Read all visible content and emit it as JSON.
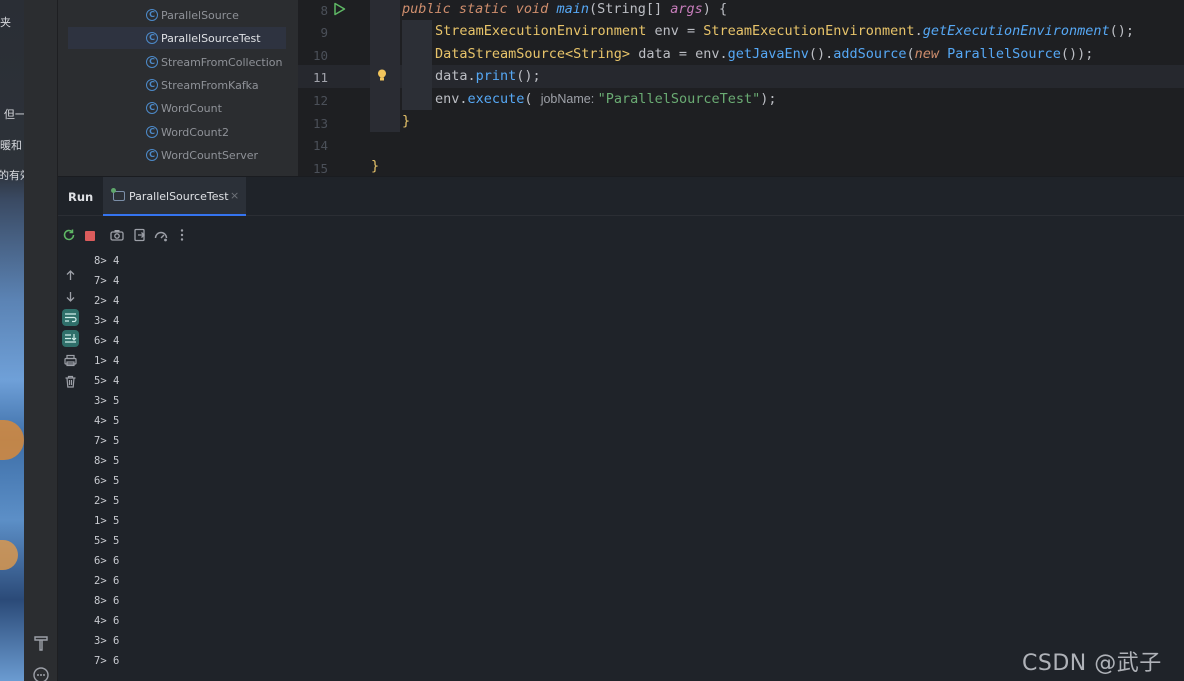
{
  "wallpaper": {
    "fragments": [
      "夹",
      "! 但一",
      "暖和",
      "的有效"
    ]
  },
  "project_tree": {
    "items": [
      {
        "label": "ParallelSource",
        "selected": false
      },
      {
        "label": "ParallelSourceTest",
        "selected": true
      },
      {
        "label": "StreamFromCollection",
        "selected": false
      },
      {
        "label": "StreamFromKafka",
        "selected": false
      },
      {
        "label": "WordCount",
        "selected": false
      },
      {
        "label": "WordCount2",
        "selected": false
      },
      {
        "label": "WordCountServer",
        "selected": false
      }
    ]
  },
  "editor": {
    "current_line": "11",
    "line_numbers": [
      "8",
      "9",
      "10",
      "11",
      "12",
      "13",
      "14",
      "15"
    ],
    "lines": {
      "l8": {
        "kw": "public static void ",
        "method": "main",
        "rest": "(String[] ",
        "param": "args",
        "end": ") {"
      },
      "l9": {
        "type": "StreamExecutionEnvironment",
        "mid": " env = ",
        "type2": "StreamExecutionEnvironment",
        "dot": ".",
        "method": "getExecutionEnvironment",
        "end": "();"
      },
      "l10": {
        "type": "DataStreamSource<String>",
        "mid": " data = env.",
        "method": "getJavaEnv",
        "mid2": "().",
        "method2": "addSource",
        "p1": "(",
        "kw": "new ",
        "cls": "ParallelSource",
        "end": "());"
      },
      "l11": {
        "pre": "data.",
        "method": "print",
        "end": "();"
      },
      "l12": {
        "pre": "env.",
        "method": "execute",
        "p": "( ",
        "hint": "jobName: ",
        "str": "\"ParallelSourceTest\"",
        "end": ");"
      },
      "l13": {
        "text": "}"
      },
      "l15": {
        "text": "}"
      }
    }
  },
  "run_panel": {
    "title": "Run",
    "tab_label": "ParallelSourceTest",
    "close_glyph": "×",
    "output": [
      "8> 4",
      "7> 4",
      "2> 4",
      "3> 4",
      "6> 4",
      "1> 4",
      "5> 4",
      "3> 5",
      "4> 5",
      "7> 5",
      "8> 5",
      "6> 5",
      "2> 5",
      "1> 5",
      "5> 5",
      "6> 6",
      "2> 6",
      "8> 6",
      "4> 6",
      "3> 6",
      "7> 6"
    ]
  },
  "icons": {
    "rerun": "rerun-icon",
    "stop": "stop-icon",
    "screenshot": "camera-icon",
    "exit": "exit-icon",
    "dump": "dump-threads-icon",
    "more": "more-icon",
    "up": "arrow-up-icon",
    "down": "arrow-down-icon",
    "softwrap": "soft-wrap-icon",
    "scrollend": "scroll-to-end-icon",
    "print": "print-icon",
    "trash": "trash-icon"
  },
  "watermark": "CSDN @武子康"
}
